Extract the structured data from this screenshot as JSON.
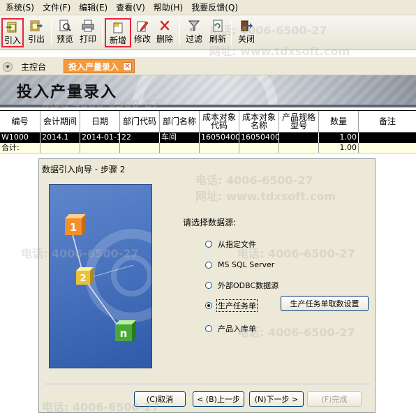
{
  "menu": [
    "系统(S)",
    "文件(F)",
    "编辑(E)",
    "查看(V)",
    "帮助(H)",
    "我要反馈(Q)"
  ],
  "toolbar": {
    "import": "引入",
    "export": "引出",
    "preview": "预览",
    "print": "打印",
    "new": "新增",
    "edit": "修改",
    "delete": "删除",
    "filter": "过滤",
    "refresh": "刷新",
    "close": "关闭"
  },
  "tabs": {
    "main": "主控台",
    "active": "投入产量录入",
    "close_glyph": "✕"
  },
  "banner_title": "投入产量录入",
  "grid": {
    "headers": [
      "编号",
      "会计期间",
      "日期",
      "部门代码",
      "部门名称",
      "成本对象代码",
      "成本对象名称",
      "产品规格型号",
      "数量",
      "备注"
    ],
    "rows": [
      [
        "W1000",
        "2014.1",
        "2014-01-1",
        "22",
        "车间",
        "1605040000",
        "1605040000",
        "",
        "1.00",
        ""
      ]
    ],
    "total": [
      "合计:",
      "",
      "",
      "",
      "",
      "",
      "",
      "",
      "1.00",
      ""
    ]
  },
  "dialog": {
    "title": "数据引入向导 - 步骤 2",
    "prompt": "请选择数据源:",
    "options": [
      "从指定文件",
      "MS  SQL Server",
      "外部ODBC数据源",
      "生产任务单",
      "产品入库单"
    ],
    "selected_index": 3,
    "setting_button": "生产任务单取数设置",
    "buttons": {
      "cancel": "(C)取消",
      "back": "< (B)上一步",
      "next": "(N)下一步 >",
      "finish": "(F)完成"
    },
    "steps": [
      "1",
      "2",
      "n"
    ]
  },
  "watermarks": {
    "phone": "电话: 4006-6500-27",
    "site": "网址: www.tdxsoft.com"
  }
}
